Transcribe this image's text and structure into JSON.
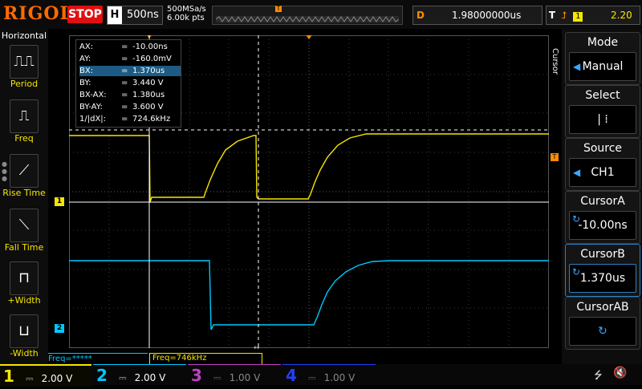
{
  "topbar": {
    "brand": "RIGOL",
    "run_state": "STOP",
    "horizontal_letter": "H",
    "timebase": "500ns",
    "sample_rate": "500MSa/s",
    "memory_depth": "6.00k pts",
    "delay_letter": "D",
    "delay": "1.98000000us",
    "trigger_letter": "T",
    "trigger_channel": "1",
    "trigger_level": "2.20 V"
  },
  "left_menu": {
    "title": "Horizontal",
    "items": [
      {
        "label": "Period",
        "icon": "period-icon"
      },
      {
        "label": "Freq",
        "icon": "frequency-icon"
      },
      {
        "label": "Rise Time",
        "icon": "rise-time-icon"
      },
      {
        "label": "Fall Time",
        "icon": "fall-time-icon"
      },
      {
        "label": "+Width",
        "icon": "positive-width-icon"
      },
      {
        "label": "-Width",
        "icon": "negative-width-icon"
      }
    ]
  },
  "cursor_readout": [
    {
      "key": "AX:",
      "value": "-10.00ns"
    },
    {
      "key": "AY:",
      "value": "-160.0mV"
    },
    {
      "key": "BX:",
      "value": "1.370us"
    },
    {
      "key": "BY:",
      "value": "3.440 V"
    },
    {
      "key": "BX-AX:",
      "value": "1.380us"
    },
    {
      "key": "BY-AY:",
      "value": "3.600 V"
    },
    {
      "key": "1/|dX|:",
      "value": "724.6kHz"
    }
  ],
  "right_menu": {
    "vertical_title": "Cursor",
    "items": [
      {
        "title": "Mode",
        "value": "Manual"
      },
      {
        "title": "Select",
        "value": "|   ⁞"
      },
      {
        "title": "Source",
        "value": "CH1"
      },
      {
        "title": "CursorA",
        "value": "-10.00ns"
      },
      {
        "title": "CursorB",
        "value": "1.370us"
      },
      {
        "title": "CursorAB",
        "value": ""
      }
    ]
  },
  "measurements": {
    "freq_ch2": "Freq=*****",
    "freq_ch1": "Freq=746kHz"
  },
  "channels": [
    {
      "number": "1",
      "scale": "2.00 V",
      "color": "#f5e600"
    },
    {
      "number": "2",
      "scale": "2.00 V",
      "color": "#00c8ff"
    },
    {
      "number": "3",
      "scale": "1.00 V",
      "color": "#c040c0"
    },
    {
      "number": "4",
      "scale": "1.00 V",
      "color": "#2040ff"
    }
  ],
  "markers": {
    "ch1_marker": "1",
    "ch2_marker": "2"
  }
}
